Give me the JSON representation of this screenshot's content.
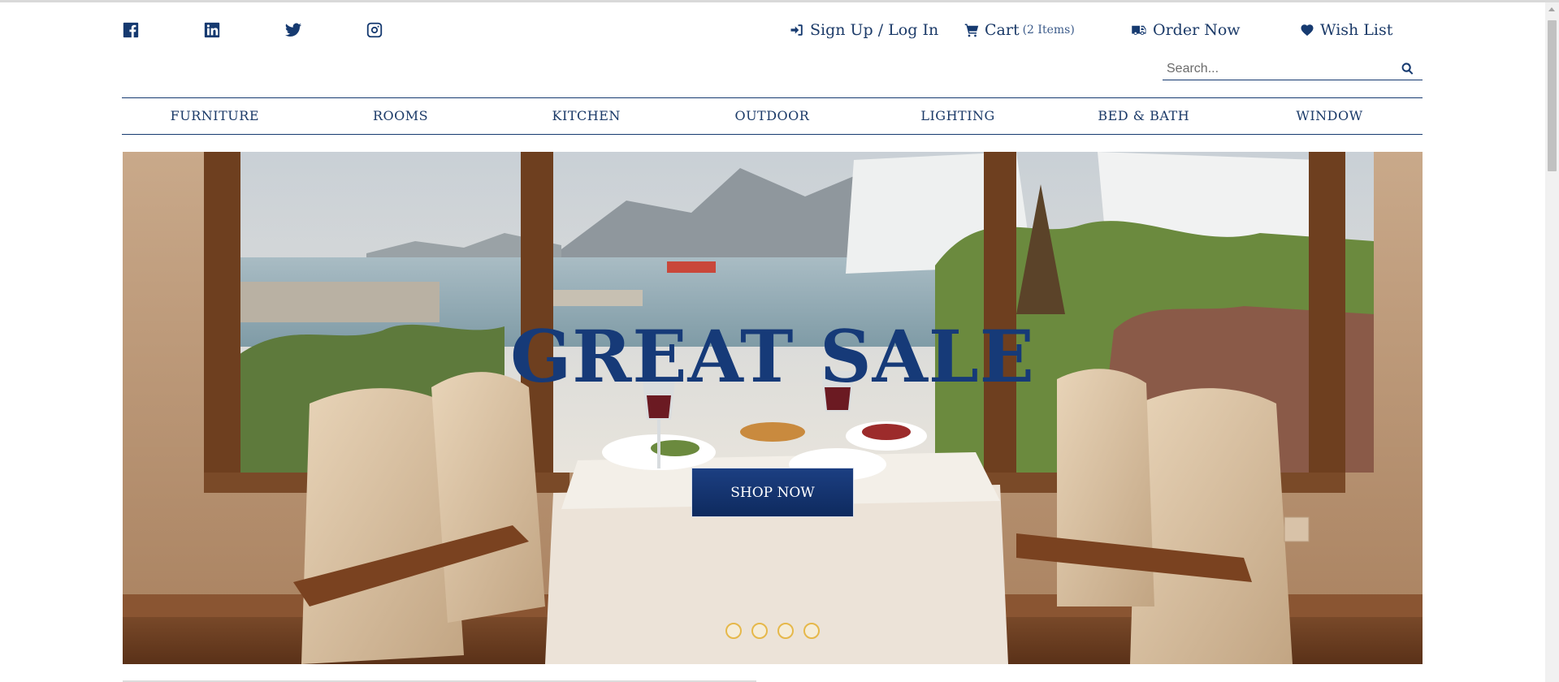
{
  "header": {
    "social_icons": [
      "facebook-icon",
      "linkedin-icon",
      "twitter-icon",
      "instagram-icon"
    ],
    "links": {
      "signup_login": "Sign Up / Log In",
      "cart": "Cart",
      "cart_count": "(2 Items)",
      "order_now": "Order Now",
      "wish_list": "Wish List"
    },
    "search": {
      "placeholder": "Search...",
      "value": ""
    }
  },
  "nav": {
    "items": [
      {
        "label": "FURNITURE"
      },
      {
        "label": "ROOMS"
      },
      {
        "label": "KITCHEN"
      },
      {
        "label": "OUTDOOR"
      },
      {
        "label": "LIGHTING"
      },
      {
        "label": "BED & BATH"
      },
      {
        "label": "WINDOW"
      }
    ]
  },
  "hero": {
    "title": "GREAT SALE",
    "button_label": "SHOP NOW",
    "slide_count": 4
  },
  "colors": {
    "brand": "#163a70",
    "button": "#163a78",
    "dot_border": "#e6b84a"
  }
}
